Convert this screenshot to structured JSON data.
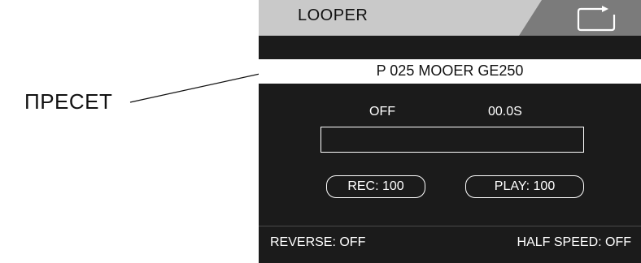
{
  "annotation": {
    "label": "ПРЕСЕТ"
  },
  "screen": {
    "title": "LOOPER",
    "icon": "loop-icon",
    "preset": "P 025 MOOER GE250",
    "status": {
      "state": "OFF",
      "time": "00.0S"
    },
    "progress": 0,
    "rec_label": "REC: 100",
    "play_label": "PLAY: 100",
    "reverse_label": "REVERSE: OFF",
    "half_speed_label": "HALF SPEED: OFF"
  },
  "colors": {
    "screen_bg": "#1b1b1b",
    "title_bar": "#c9c9c9",
    "title_accent": "#7b7b7b",
    "text_on_screen": "#ffffff"
  }
}
